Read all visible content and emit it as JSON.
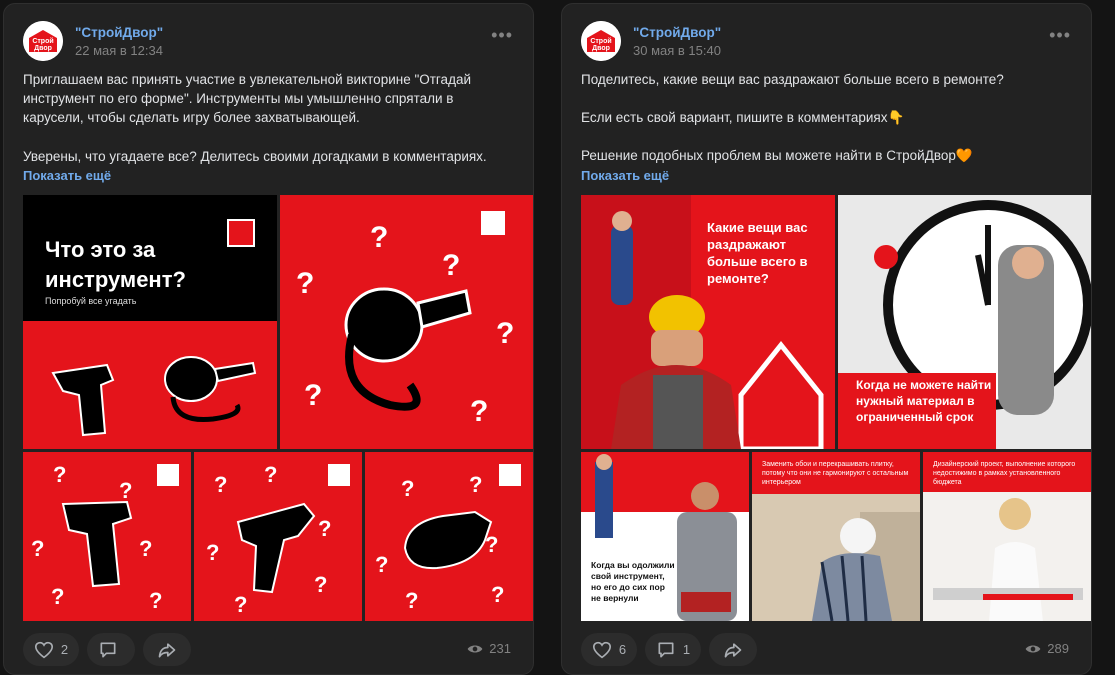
{
  "posts": [
    {
      "author": "\"СтройДвор\"",
      "date": "22 мая в 12:34",
      "paragraphs": [
        "Приглашаем вас принять участие в увлекательной викторине \"Отгадай инструмент по его форме\". Инструменты мы умышленно спрятали в карусели, чтобы сделать игру более захватывающей.",
        "Уверены, что угадаете все? Делитесь своими догадками в комментариях."
      ],
      "show_more": "Показать ещё",
      "images": {
        "main_title": "Что это за инструмент?",
        "main_subtitle": "Попробуй все угадать"
      },
      "likes": "2",
      "comments": "",
      "views": "231"
    },
    {
      "author": "\"СтройДвор\"",
      "date": "30 мая в 15:40",
      "paragraphs": [
        "Поделитесь, какие вещи вас раздражают больше всего в ремонте?",
        "Если есть свой вариант, пишите в комментариях👇",
        "Решение подобных проблем вы можете найти в СтройДвор🧡"
      ],
      "show_more": "Показать ещё",
      "images": {
        "main_title": "Какие вещи вас раздражают больше всего в ремонте?",
        "tile2_text": "Когда не можете найти нужный материал в ограниченный срок",
        "tile3_text": "Когда вы одолжили свой инструмент, но его до сих пор не вернули",
        "tile4_text": "Заменить обои и перекрашивать плитку, потому что они не гармонируют с остальным интерьером",
        "tile5_text": "Дизайнерский проект, выполнение которого недостижимо в рамках установленного бюджета"
      },
      "likes": "6",
      "comments": "1",
      "views": "289"
    }
  ],
  "brand": {
    "logo_text_1": "Строй",
    "logo_text_2": "Двор",
    "red": "#e4141b",
    "link": "#71aaeb"
  },
  "icons": {
    "more": "more-icon",
    "like": "heart-icon",
    "comment": "comment-icon",
    "share": "share-icon",
    "views": "eye-icon"
  }
}
